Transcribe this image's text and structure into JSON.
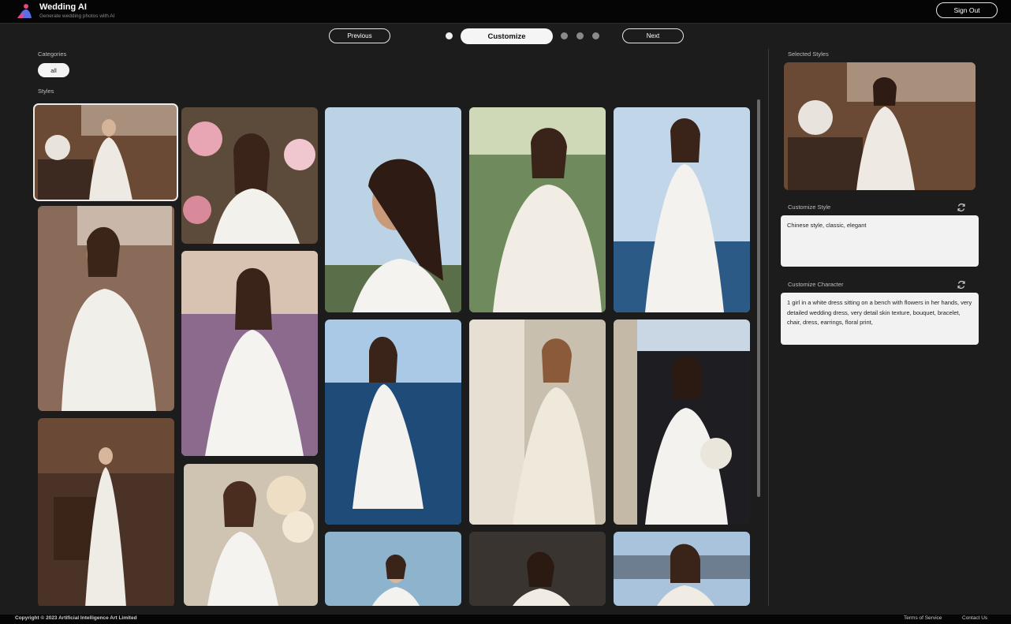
{
  "header": {
    "app_title": "Wedding AI",
    "app_subtitle": "Generate wedding photos with AI",
    "sign_out_label": "Sign Out"
  },
  "stepper": {
    "previous_label": "Previous",
    "current_step_label": "Customize",
    "next_label": "Next",
    "current_step": 2,
    "total_steps": 5
  },
  "left": {
    "categories_label": "Categories",
    "categories": [
      {
        "label": "all",
        "selected": true
      }
    ],
    "styles_label": "Styles",
    "styles": [
      {
        "id": "style-1",
        "selected": true
      },
      {
        "id": "style-2"
      },
      {
        "id": "style-3"
      },
      {
        "id": "style-4"
      },
      {
        "id": "style-5"
      },
      {
        "id": "style-6"
      },
      {
        "id": "style-7"
      },
      {
        "id": "style-8"
      },
      {
        "id": "style-9"
      },
      {
        "id": "style-10"
      },
      {
        "id": "style-11"
      },
      {
        "id": "style-12"
      },
      {
        "id": "style-13"
      },
      {
        "id": "style-14"
      },
      {
        "id": "style-15"
      }
    ]
  },
  "right": {
    "selected_styles_label": "Selected Styles",
    "customize_style_label": "Customize Style",
    "customize_style_value": "Chinese style, classic, elegant",
    "customize_character_label": "Customize Character",
    "customize_character_value": "1 girl in a white dress sitting on a bench with flowers in her hands, very detailed wedding dress, very detail skin texture, bouquet, bracelet, chair, dress, earrings, floral print,"
  },
  "footer": {
    "copyright": "Copyright © 2023 Artificial Intelligence Art Limited",
    "terms_label": "Terms of Service",
    "contact_label": "Contact Us"
  },
  "colors": {
    "background": "#1c1c1c",
    "header_bg": "#050505",
    "accent_white": "#f5f5f5"
  },
  "icons": [
    "wedding-ai-logo-icon",
    "refresh-icon"
  ]
}
